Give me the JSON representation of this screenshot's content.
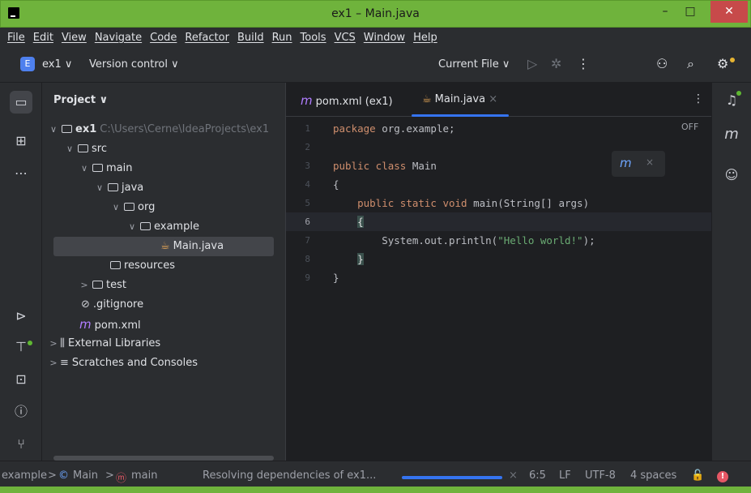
{
  "window": {
    "title": "ex1 – Main.java",
    "minimize": "–",
    "maximize": "□",
    "close": "✕"
  },
  "menu": [
    "File",
    "Edit",
    "View",
    "Navigate",
    "Code",
    "Refactor",
    "Build",
    "Run",
    "Tools",
    "VCS",
    "Window",
    "Help"
  ],
  "toolbar": {
    "project_badge": "E",
    "project_name": "ex1 ∨",
    "version_control": "Version control ∨",
    "run_config": "Current File ∨",
    "icons": [
      "run-icon",
      "debug-icon",
      "more-icon",
      "add-user-icon",
      "search-icon",
      "settings-icon"
    ]
  },
  "project_panel": {
    "header": "Project ∨",
    "tree": [
      {
        "label": "ex1",
        "path": "C:\\Users\\Cerne\\IdeaProjects\\ex1",
        "chevron": "∨",
        "depth": 0,
        "icon": "module-folder"
      },
      {
        "label": "src",
        "chevron": "∨",
        "depth": 1,
        "icon": "folder"
      },
      {
        "label": "main",
        "chevron": "∨",
        "depth": 2,
        "icon": "folder"
      },
      {
        "label": "java",
        "chevron": "∨",
        "depth": 3,
        "icon": "folder"
      },
      {
        "label": "org",
        "chevron": "∨",
        "depth": 4,
        "icon": "folder"
      },
      {
        "label": "example",
        "chevron": "∨",
        "depth": 5,
        "icon": "folder"
      },
      {
        "label": "Main.java",
        "chevron": "",
        "depth": 6,
        "icon": "java-class",
        "selected": true
      },
      {
        "label": "resources",
        "chevron": "",
        "depth": 3,
        "icon": "folder"
      },
      {
        "label": "test",
        "chevron": ">",
        "depth": 2,
        "icon": "folder"
      },
      {
        "label": ".gitignore",
        "chevron": "",
        "depth": 2,
        "icon": "ignore"
      },
      {
        "label": "pom.xml",
        "chevron": "",
        "depth": 2,
        "icon": "maven"
      },
      {
        "label": "External Libraries",
        "chevron": ">",
        "depth": 0,
        "icon": "library"
      },
      {
        "label": "Scratches and Consoles",
        "chevron": ">",
        "depth": 0,
        "icon": "scratch"
      }
    ]
  },
  "editor": {
    "tabs": [
      {
        "label": "pom.xml (ex1)",
        "icon": "maven-icon",
        "active": false
      },
      {
        "label": "Main.java",
        "icon": "java-icon",
        "active": true,
        "close": "×"
      }
    ],
    "more": "⋮",
    "off_label": "OFF",
    "maven_popup": {
      "icon": "m",
      "close": "×"
    },
    "current_line": 6,
    "lines": [
      {
        "n": "1",
        "tokens": [
          {
            "t": "kw",
            "v": "package"
          },
          {
            "t": "txt",
            "v": " org.example;"
          }
        ]
      },
      {
        "n": "2",
        "tokens": []
      },
      {
        "n": "3",
        "tokens": [
          {
            "t": "kw",
            "v": "public class"
          },
          {
            "t": "txt",
            "v": " Main"
          }
        ]
      },
      {
        "n": "4",
        "tokens": [
          {
            "t": "txt",
            "v": "{"
          }
        ]
      },
      {
        "n": "5",
        "tokens": [
          {
            "t": "txt",
            "v": "    "
          },
          {
            "t": "kw",
            "v": "public static void"
          },
          {
            "t": "txt",
            "v": " main(String[] args)"
          }
        ]
      },
      {
        "n": "6",
        "tokens": [
          {
            "t": "txt",
            "v": "    "
          },
          {
            "t": "hl",
            "v": "{"
          }
        ]
      },
      {
        "n": "7",
        "tokens": [
          {
            "t": "txt",
            "v": "        System.out.println("
          },
          {
            "t": "str",
            "v": "\"Hello world!\""
          },
          {
            "t": "txt",
            "v": ");"
          }
        ]
      },
      {
        "n": "8",
        "tokens": [
          {
            "t": "txt",
            "v": "    "
          },
          {
            "t": "hl",
            "v": "}"
          }
        ]
      },
      {
        "n": "9",
        "tokens": [
          {
            "t": "txt",
            "v": "}"
          }
        ]
      }
    ]
  },
  "status": {
    "breadcrumb_1": "example",
    "sep": ">",
    "breadcrumb_2": "Main",
    "breadcrumb_3": "main",
    "task": "Resolving dependencies of ex1...",
    "cancel": "×",
    "position": "6:5",
    "line_sep": "LF",
    "encoding": "UTF-8",
    "indent": "4 spaces",
    "lock": "🔓",
    "error": "!"
  },
  "colors": {
    "titlebar": "#6fb33c",
    "accent": "#3574f0",
    "keyword": "#cf8e6d",
    "string": "#6aab73"
  }
}
